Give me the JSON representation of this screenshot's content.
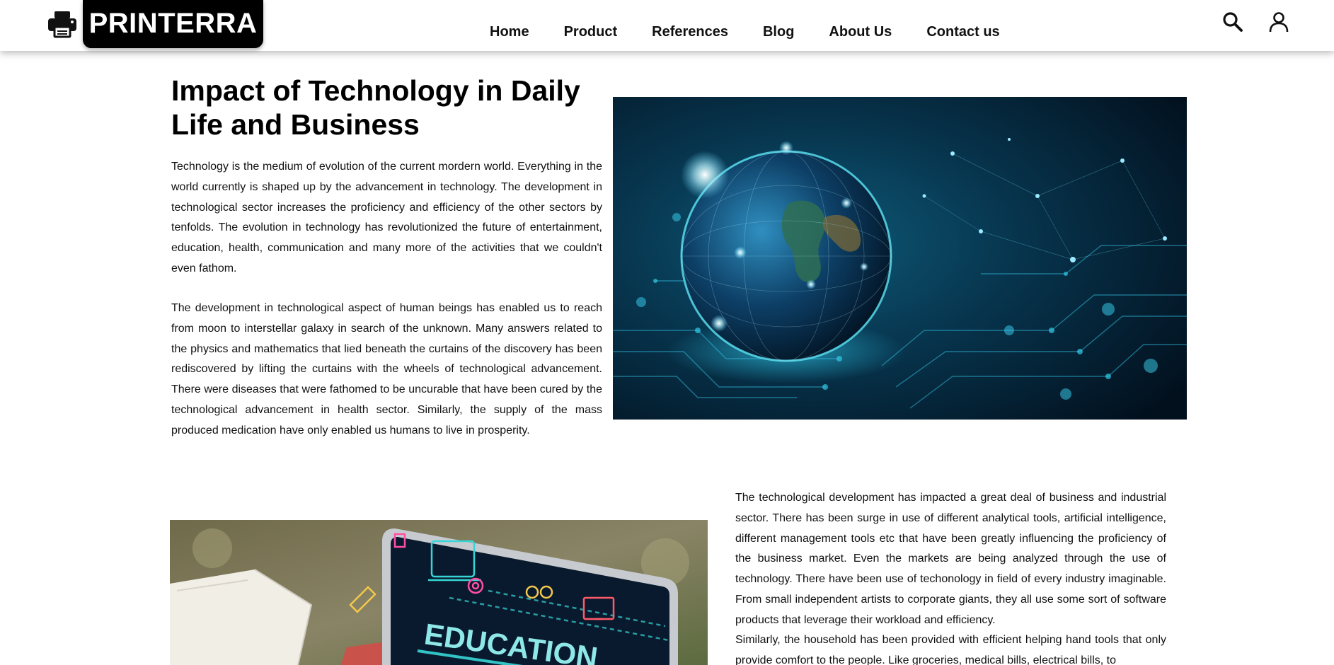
{
  "brand": {
    "name": "PRINTERRA",
    "icon": "printer-icon"
  },
  "nav": {
    "items": [
      {
        "label": "Home"
      },
      {
        "label": "Product"
      },
      {
        "label": "References"
      },
      {
        "label": "Blog"
      },
      {
        "label": "About Us"
      },
      {
        "label": "Contact us"
      }
    ]
  },
  "header_icons": {
    "search": "search-icon",
    "account": "user-icon"
  },
  "article": {
    "title": "Impact of Technology in Daily Life and Business",
    "paragraph_1": "Technology is the medium of evolution of the current mordern world. Everything in the world currently is shaped up by the advancement in technology. The development in technological sector increases the proficiency and efficiency of the other sectors by tenfolds. The evolution in technology has revolutionized the future of entertainment, education, health, communication and many more of the activities that we couldn't even fathom.",
    "paragraph_2": "The development in technological aspect of human beings has enabled us to reach from moon to interstellar galaxy in search of the unknown. Many answers related to the physics and mathematics that lied beneath the curtains of the discovery has been rediscovered by lifting the curtains with the wheels of technological advancement. There were diseases that were fathomed to be uncurable that have been cured by the technological advancement in health sector. Similarly, the supply of the mass produced medication have only enabled us humans to live in prosperity.",
    "paragraph_3": "The technological development has impacted a great deal of business and industrial sector. There has been surge in use of different analytical tools, artificial intelligence, different management tools etc that have been greatly influencing the proficiency of the business market. Even the markets are being analyzed through the use of technology. There have been use of techonology in field of every industry imaginable. From small independent artists to corporate giants, they all use some sort of software products that leverage their workload and efficiency.",
    "paragraph_4": "Similarly, the household has been provided with efficient helping hand tools that only provide comfort to the people. Like groceries, medical bills, electrical bills, to",
    "edu_image_text": "EDUCATION"
  },
  "colors": {
    "hero_bg": "#04263a",
    "accent_cyan": "#33e0e8",
    "edu_screen": "#0a1a2e"
  }
}
